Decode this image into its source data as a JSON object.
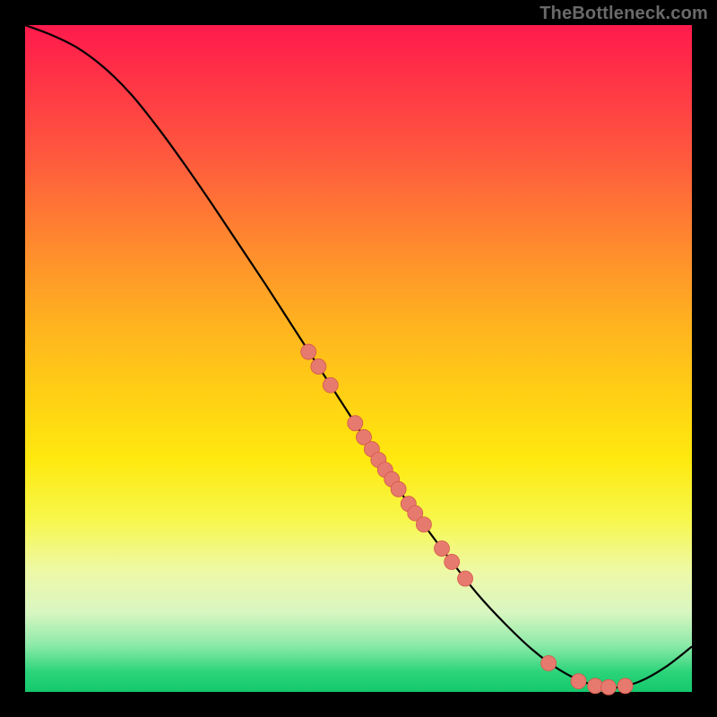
{
  "watermark": "TheBottleneck.com",
  "colors": {
    "frame": "#000000",
    "curve": "#000000",
    "marker_fill": "#e77a6f",
    "marker_stroke": "#d4584a"
  },
  "chart_data": {
    "type": "line",
    "title": "",
    "xlabel": "",
    "ylabel": "",
    "xlim": [
      0,
      100
    ],
    "ylim": [
      0,
      100
    ],
    "grid": false,
    "legend": false,
    "series": [
      {
        "name": "bottleneck-curve",
        "x": [
          0,
          4,
          8,
          12,
          16,
          20,
          24,
          28,
          32,
          36,
          40,
          44,
          48,
          52,
          56,
          60,
          64,
          68,
          72,
          76,
          80,
          84,
          88,
          92,
          96,
          100
        ],
        "y": [
          100,
          98.5,
          96.5,
          93.5,
          89.5,
          84.5,
          79.0,
          73.2,
          67.2,
          61.2,
          55.0,
          48.8,
          42.6,
          36.4,
          30.4,
          24.8,
          19.5,
          14.5,
          10.2,
          6.4,
          3.4,
          1.4,
          0.6,
          1.5,
          3.7,
          6.8
        ]
      }
    ],
    "markers": [
      {
        "x": 42.5,
        "y": 51.0
      },
      {
        "x": 44.0,
        "y": 48.8
      },
      {
        "x": 45.8,
        "y": 46.0
      },
      {
        "x": 49.5,
        "y": 40.3
      },
      {
        "x": 50.8,
        "y": 38.2
      },
      {
        "x": 52.0,
        "y": 36.4
      },
      {
        "x": 53.0,
        "y": 34.8
      },
      {
        "x": 54.0,
        "y": 33.3
      },
      {
        "x": 55.0,
        "y": 31.9
      },
      {
        "x": 56.0,
        "y": 30.4
      },
      {
        "x": 57.5,
        "y": 28.2
      },
      {
        "x": 58.5,
        "y": 26.8
      },
      {
        "x": 59.8,
        "y": 25.1
      },
      {
        "x": 62.5,
        "y": 21.5
      },
      {
        "x": 64.0,
        "y": 19.5
      },
      {
        "x": 66.0,
        "y": 17.0
      },
      {
        "x": 78.5,
        "y": 4.3
      },
      {
        "x": 83.0,
        "y": 1.6
      },
      {
        "x": 85.5,
        "y": 0.9
      },
      {
        "x": 87.5,
        "y": 0.7
      },
      {
        "x": 90.0,
        "y": 0.9
      }
    ]
  }
}
